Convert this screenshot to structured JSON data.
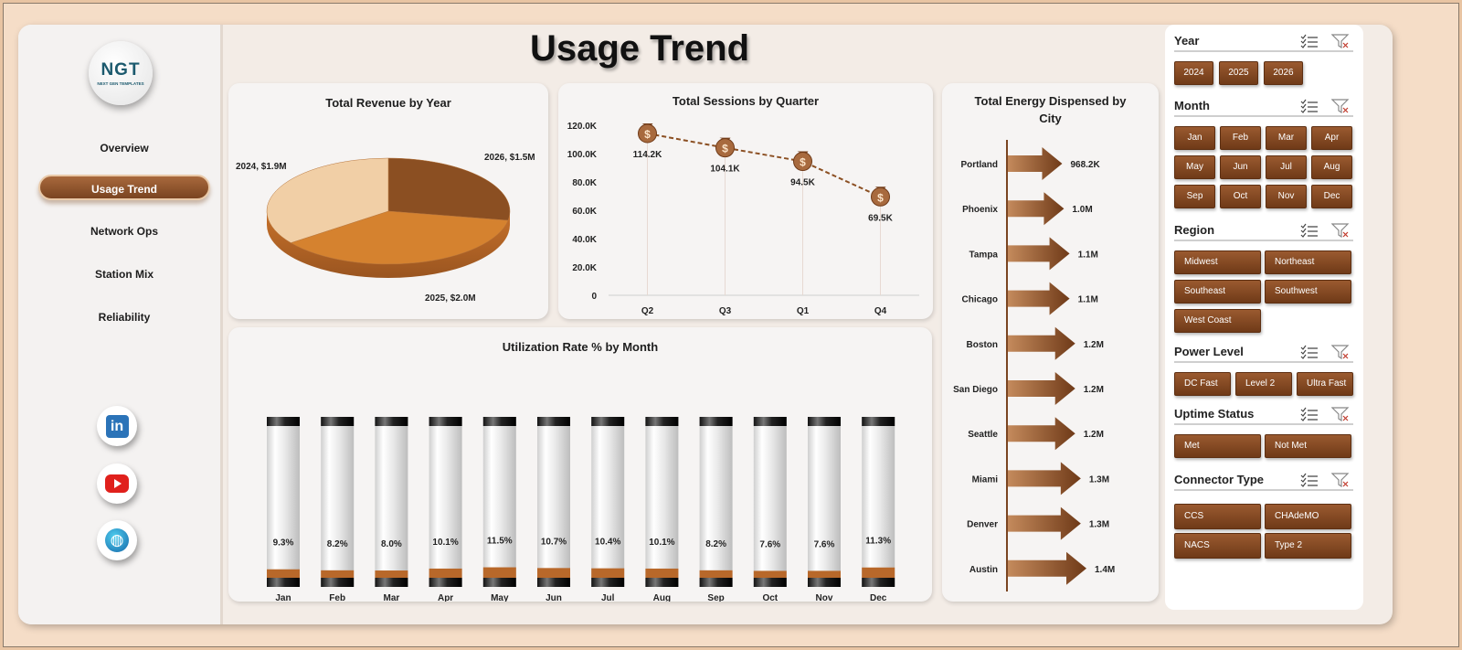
{
  "title": "Usage Trend",
  "logo": {
    "text": "NGT",
    "subtitle": "NEXT GEN TEMPLATES"
  },
  "nav": [
    {
      "label": "Overview",
      "active": false
    },
    {
      "label": "Usage Trend",
      "active": true
    },
    {
      "label": "Network Ops",
      "active": false
    },
    {
      "label": "Station Mix",
      "active": false
    },
    {
      "label": "Reliability",
      "active": false
    }
  ],
  "social": [
    "linkedin-icon",
    "youtube-icon",
    "globe-icon"
  ],
  "colors": {
    "accent": "#7a4420",
    "pie_dark": "#8b4f22",
    "pie_mid": "#d5822f",
    "pie_light": "#f1cfa6"
  },
  "charts": {
    "revenue": {
      "title": "Total Revenue by Year",
      "labels": [
        "2024, $1.9M",
        "2026, $1.5M",
        "2025, $2.0M"
      ]
    },
    "sessions": {
      "title": "Total Sessions by Quarter",
      "y_ticks": [
        "120.0K",
        "100.0K",
        "80.0K",
        "60.0K",
        "40.0K",
        "20.0K",
        "0"
      ],
      "point_labels": [
        "114.2K",
        "104.1K",
        "94.5K",
        "69.5K"
      ]
    },
    "energy": {
      "title": "Total Energy Dispensed by City"
    },
    "utilization": {
      "title": "Utilization Rate % by Month"
    }
  },
  "chart_data": [
    {
      "type": "pie",
      "title": "Total Revenue by Year",
      "categories": [
        "2024",
        "2025",
        "2026"
      ],
      "values": [
        1.9,
        2.0,
        1.5
      ],
      "unit": "$M"
    },
    {
      "type": "line",
      "title": "Total Sessions by Quarter",
      "categories": [
        "Q2",
        "Q3",
        "Q1",
        "Q4"
      ],
      "values": [
        114200,
        104100,
        94500,
        69500
      ],
      "ylim": [
        0,
        120000
      ]
    },
    {
      "type": "bar",
      "title": "Total Energy Dispensed by City",
      "categories": [
        "Portland",
        "Phoenix",
        "Tampa",
        "Chicago",
        "Boston",
        "San Diego",
        "Seattle",
        "Miami",
        "Denver",
        "Austin"
      ],
      "values": [
        968200,
        1000000,
        1100000,
        1100000,
        1200000,
        1200000,
        1200000,
        1300000,
        1300000,
        1400000
      ],
      "data_labels": [
        "968.2K",
        "1.0M",
        "1.1M",
        "1.1M",
        "1.2M",
        "1.2M",
        "1.2M",
        "1.3M",
        "1.3M",
        "1.4M"
      ]
    },
    {
      "type": "bar",
      "title": "Utilization Rate % by Month",
      "categories": [
        "Jan",
        "Feb",
        "Mar",
        "Apr",
        "May",
        "Jun",
        "Jul",
        "Aug",
        "Sep",
        "Oct",
        "Nov",
        "Dec"
      ],
      "values": [
        9.3,
        8.2,
        8.0,
        10.1,
        11.5,
        10.7,
        10.4,
        10.1,
        8.2,
        7.6,
        7.6,
        11.3
      ],
      "data_labels": [
        "9.3%",
        "8.2%",
        "8.0%",
        "10.1%",
        "11.5%",
        "10.7%",
        "10.4%",
        "10.1%",
        "8.2%",
        "7.6%",
        "7.6%",
        "11.3%"
      ]
    }
  ],
  "slicers": [
    {
      "title": "Year",
      "items": [
        "2024",
        "2025",
        "2026"
      ]
    },
    {
      "title": "Month",
      "items": [
        "Jan",
        "Feb",
        "Mar",
        "Apr",
        "May",
        "Jun",
        "Jul",
        "Aug",
        "Sep",
        "Oct",
        "Nov",
        "Dec"
      ]
    },
    {
      "title": "Region",
      "items": [
        "Midwest",
        "Northeast",
        "Southeast",
        "Southwest",
        "West Coast"
      ]
    },
    {
      "title": "Power Level",
      "items": [
        "DC Fast",
        "Level 2",
        "Ultra Fast"
      ]
    },
    {
      "title": "Uptime Status",
      "items": [
        "Met",
        "Not Met"
      ]
    },
    {
      "title": "Connector Type",
      "items": [
        "CCS",
        "CHAdeMO",
        "NACS",
        "Type 2"
      ]
    }
  ]
}
